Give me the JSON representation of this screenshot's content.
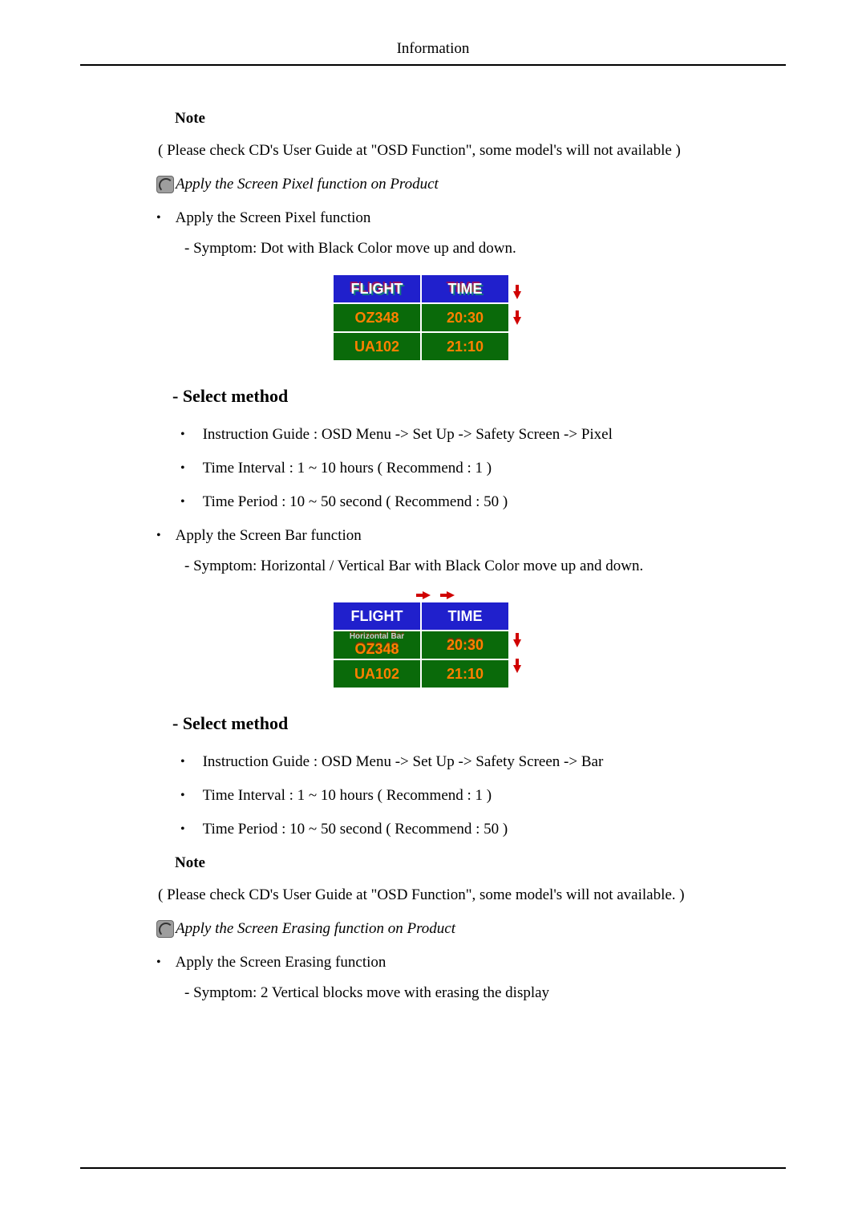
{
  "header": {
    "title": "Information"
  },
  "note1": {
    "label": "Note",
    "text": "( Please check CD's User Guide at \"OSD Function\", some model's will not available )"
  },
  "apply_pixel": {
    "caption": "Apply the Screen Pixel function on Product",
    "bullet": "Apply the Screen Pixel function",
    "symptom": "- Symptom: Dot with Black Color move up and down."
  },
  "fig1": {
    "head_flight": "FLIGHT",
    "head_time": "TIME",
    "r1c1": "OZ348",
    "r1c2": "20:30",
    "r2c1": "UA102",
    "r2c2": "21:10"
  },
  "select1": {
    "heading": "- Select method",
    "items": [
      "Instruction Guide : OSD Menu -> Set Up -> Safety Screen -> Pixel",
      "Time Interval : 1 ~ 10 hours ( Recommend : 1 )",
      "Time Period : 10 ~ 50 second ( Recommend : 50 )"
    ]
  },
  "apply_bar": {
    "bullet": "Apply the Screen Bar function",
    "symptom": "- Symptom: Horizontal / Vertical Bar with Black Color move up and down."
  },
  "fig2": {
    "head_flight": "FLIGHT",
    "head_time": "TIME",
    "hbar_label": "Horizontal Bar",
    "r1c1": "OZ348",
    "r1c2": "20:30",
    "r2c1": "UA102",
    "r2c2": "21:10"
  },
  "select2": {
    "heading": "- Select method",
    "items": [
      "Instruction Guide : OSD Menu -> Set Up -> Safety Screen -> Bar",
      "Time Interval : 1 ~ 10 hours ( Recommend : 1 )",
      "Time Period : 10 ~ 50 second ( Recommend : 50 )"
    ]
  },
  "note2": {
    "label": "Note",
    "text": "( Please check CD's User Guide at \"OSD Function\", some model's will not available. )"
  },
  "apply_erasing": {
    "caption": "Apply the Screen Erasing function on Product",
    "bullet": "Apply the Screen Erasing function",
    "symptom": "- Symptom: 2 Vertical blocks move with erasing the display"
  }
}
